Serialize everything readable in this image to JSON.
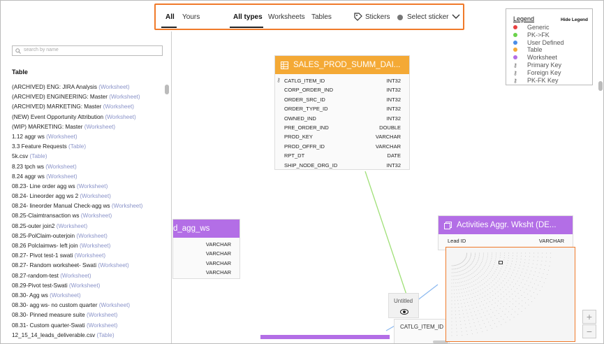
{
  "nav": {
    "tabs_left": [
      {
        "label": "All",
        "active": true
      },
      {
        "label": "Yours",
        "active": false
      }
    ],
    "tabs_types": [
      {
        "label": "All types",
        "active": true
      },
      {
        "label": "Worksheets",
        "active": false
      },
      {
        "label": "Tables",
        "active": false
      }
    ],
    "stickers_label": "Stickers",
    "select_sticker_label": "Select sticker"
  },
  "sidebar": {
    "search_placeholder": "search by name",
    "title": "Table",
    "items": [
      {
        "name": "(ARCHIVED) ENG: JIRA Analysis",
        "kind": "(Worksheet)"
      },
      {
        "name": "(ARCHIVED) ENGINEERING: Master",
        "kind": "(Worksheet)"
      },
      {
        "name": "(ARCHIVED) MARKETING: Master",
        "kind": "(Worksheet)"
      },
      {
        "name": "(NEW) Event Opportunity Attribution",
        "kind": "(Worksheet)"
      },
      {
        "name": "(WIP) MARKETING: Master",
        "kind": "(Worksheet)"
      },
      {
        "name": "1.12 aggr ws",
        "kind": "(Worksheet)"
      },
      {
        "name": "3.3 Feature Requests",
        "kind": "(Table)"
      },
      {
        "name": "5k.csv",
        "kind": "(Table)"
      },
      {
        "name": "8.23 tpch ws",
        "kind": "(Worksheet)"
      },
      {
        "name": "8.24 aggr ws",
        "kind": "(Worksheet)"
      },
      {
        "name": "08.23- Line order agg ws",
        "kind": "(Worksheet)"
      },
      {
        "name": "08.24- Lineorder agg ws 2",
        "kind": "(Worksheet)"
      },
      {
        "name": "08.24- lineorder Manual Check-agg ws",
        "kind": "(Worksheet)"
      },
      {
        "name": "08.25-Claimtransaction ws",
        "kind": "(Worksheet)"
      },
      {
        "name": "08.25-outer join2",
        "kind": "(Worksheet)"
      },
      {
        "name": "08.25-PolClaim-outerjoin",
        "kind": "(Worksheet)"
      },
      {
        "name": "08.26 Polclaimws- left join",
        "kind": "(Worksheet)"
      },
      {
        "name": "08.27- Pivot test-1 swati",
        "kind": "(Worksheet)"
      },
      {
        "name": "08.27- Random worksheet- Swati",
        "kind": "(Worksheet)"
      },
      {
        "name": "08.27-random-test",
        "kind": "(Worksheet)"
      },
      {
        "name": "08.29-Pivot test-Swati",
        "kind": "(Worksheet)"
      },
      {
        "name": "08.30- Agg ws",
        "kind": "(Worksheet)"
      },
      {
        "name": "08.30- agg ws- no custom quarter",
        "kind": "(Worksheet)"
      },
      {
        "name": "08.30- Pinned measure suite",
        "kind": "(Worksheet)"
      },
      {
        "name": "08.31- Custom quarter-Swati",
        "kind": "(Worksheet)"
      },
      {
        "name": "12_15_14_leads_deliverable.csv",
        "kind": "(Table)"
      }
    ]
  },
  "cards": {
    "sales": {
      "title": "SALES_PROD_SUMM_DAI...",
      "color": "#f4a935",
      "rows": [
        {
          "name": "CATLG_ITEM_ID",
          "type": "INT32"
        },
        {
          "name": "CORP_ORDER_IND",
          "type": "INT32"
        },
        {
          "name": "ORDER_SRC_ID",
          "type": "INT32"
        },
        {
          "name": "ORDER_TYPE_ID",
          "type": "INT32"
        },
        {
          "name": "OWNED_IND",
          "type": "INT32"
        },
        {
          "name": "PRE_ORDER_IND",
          "type": "DOUBLE"
        },
        {
          "name": "PROD_KEY",
          "type": "VARCHAR"
        },
        {
          "name": "PROD_OFFR_ID",
          "type": "VARCHAR"
        },
        {
          "name": "RPT_DT",
          "type": "DATE"
        },
        {
          "name": "SHIP_NODE_ORG_ID",
          "type": "INT32"
        }
      ]
    },
    "agg": {
      "title": "d_agg_ws",
      "color": "#b36ee6",
      "rows": [
        {
          "type": "VARCHAR"
        },
        {
          "type": "VARCHAR"
        },
        {
          "type": "VARCHAR"
        },
        {
          "type": "VARCHAR"
        }
      ]
    },
    "activities": {
      "title": "Activities Aggr. Wksht (DE...",
      "color": "#b36ee6",
      "rows": [
        {
          "name": "Lead ID",
          "type": "VARCHAR"
        }
      ]
    },
    "catlg_label": "CATLG_ITEM_ID",
    "untitled_label": "Untitled"
  },
  "legend": {
    "title": "Legend",
    "hide_label": "Hide Legend",
    "items": [
      {
        "label": "Generic",
        "color": "#e84040",
        "icon": "dot"
      },
      {
        "label": "PK->FK",
        "color": "#6ad24a",
        "icon": "dot"
      },
      {
        "label": "User Defined",
        "color": "#4a8de8",
        "icon": "dot"
      },
      {
        "label": "Table",
        "color": "#f4a935",
        "icon": "dot"
      },
      {
        "label": "Worksheet",
        "color": "#b36ee6",
        "icon": "dot"
      },
      {
        "label": "Primary Key",
        "icon": "primary-key-icon"
      },
      {
        "label": "Foreign Key",
        "icon": "foreign-key-icon"
      },
      {
        "label": "PK-FK Key",
        "icon": "pk-fk-key-icon"
      }
    ]
  },
  "zoom": {
    "plus": "+",
    "minus": "−"
  }
}
